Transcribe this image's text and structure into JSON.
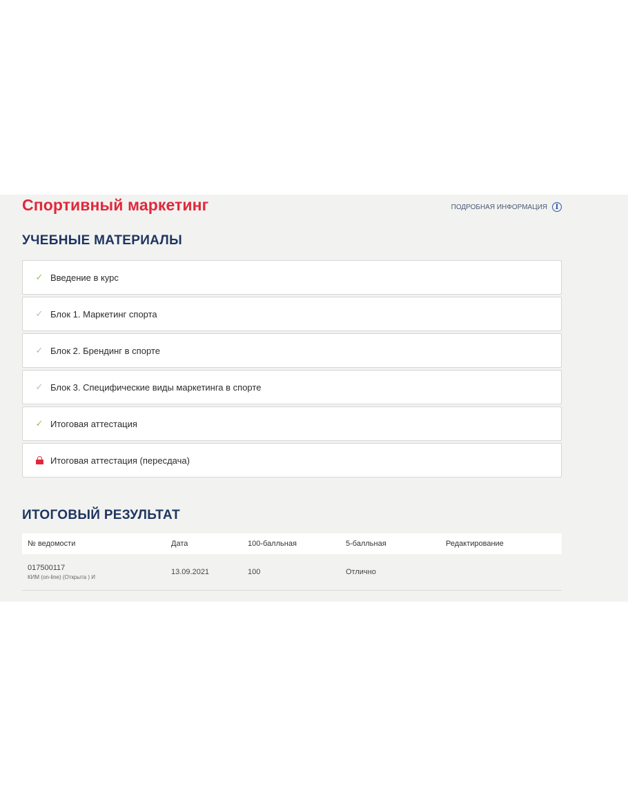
{
  "course": {
    "title": "Спортивный маркетинг",
    "info_link": "ПОДРОБНАЯ ИНФОРМАЦИЯ",
    "info_icon": "info-circle-icon"
  },
  "materials": {
    "title": "УЧЕБНЫЕ МАТЕРИАЛЫ",
    "items": [
      {
        "label": "Введение в курс",
        "status": "completed",
        "icon": "check-icon"
      },
      {
        "label": "Блок 1. Маркетинг спорта",
        "status": "pending",
        "icon": "check-icon"
      },
      {
        "label": "Блок 2. Брендинг в спорте",
        "status": "pending",
        "icon": "check-icon"
      },
      {
        "label": "Блок 3. Специфические виды маркетинга в спорте",
        "status": "pending",
        "icon": "check-icon"
      },
      {
        "label": "Итоговая аттестация",
        "status": "completed",
        "icon": "check-icon"
      },
      {
        "label": "Итоговая аттестация (пересдача)",
        "status": "locked",
        "icon": "lock-icon"
      }
    ]
  },
  "result": {
    "title": "ИТОГОВЫЙ РЕЗУЛЬТАТ",
    "columns": [
      "№ ведомости",
      "Дата",
      "100-балльная",
      "5-балльная",
      "Редактирование"
    ],
    "rows": [
      {
        "sheet_number": "017500117",
        "sheet_desc": "КИМ (on-line) (Открыта ) И",
        "date": "13.09.2021",
        "score_100": "100",
        "score_5": "Отлично",
        "edit": ""
      }
    ]
  },
  "colors": {
    "accent_red": "#e0283b",
    "heading_navy": "#1e3560",
    "check_green": "#8cc63f",
    "check_grey": "#b8b8b8",
    "panel_bg": "#f2f2f0"
  }
}
